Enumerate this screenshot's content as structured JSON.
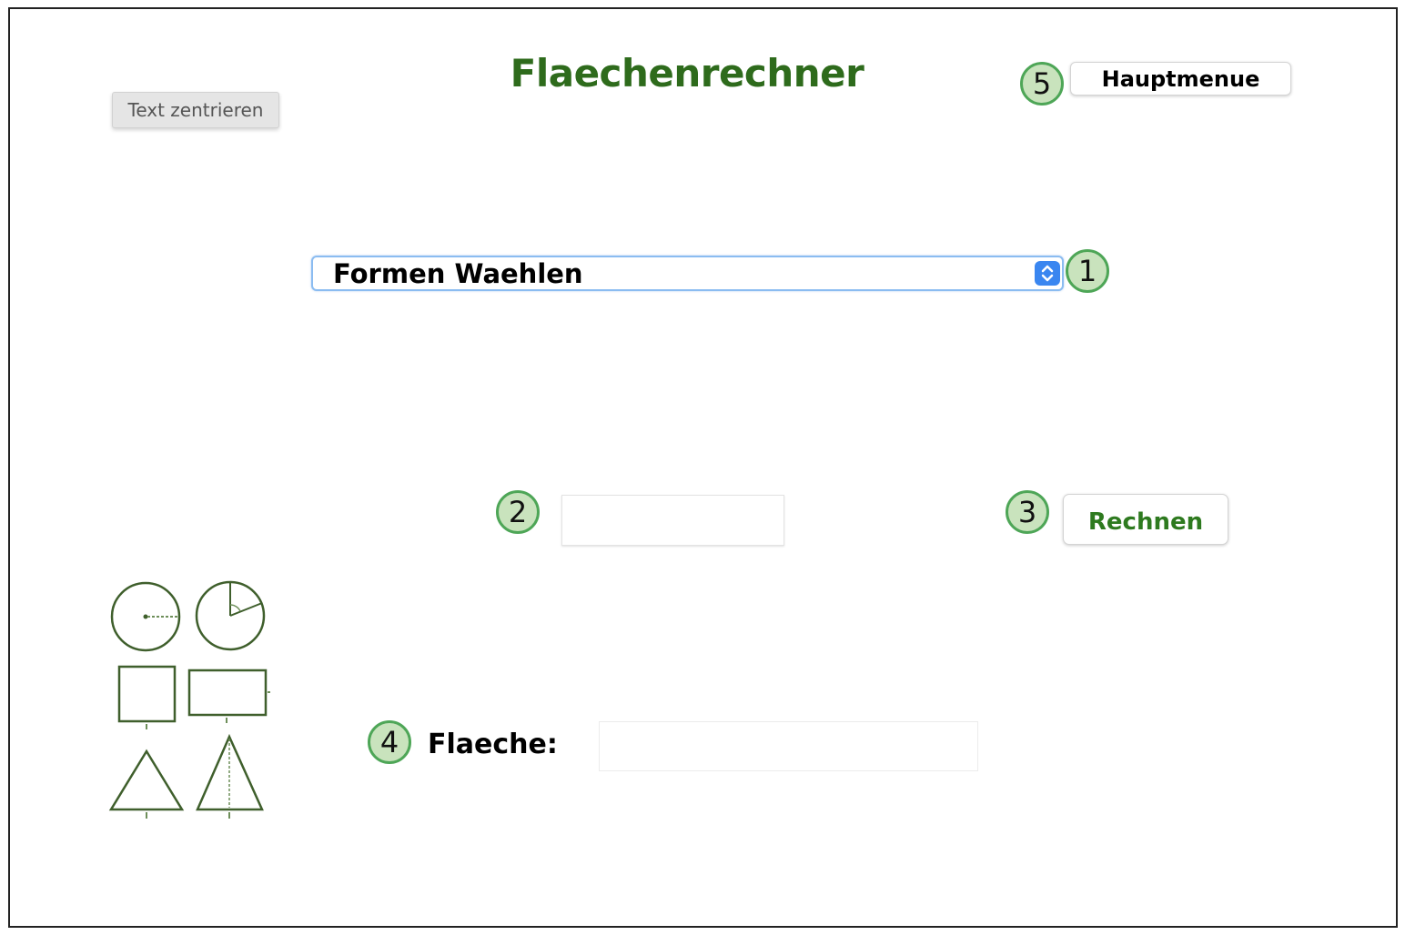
{
  "app": {
    "title": "Flaechenrechner"
  },
  "toolbar": {
    "center_text_label": "Text zentrieren",
    "main_menu_label": "Hauptmenue"
  },
  "form": {
    "shape_select": {
      "selected": "Formen Waehlen"
    },
    "input_value": "",
    "calculate_label": "Rechnen",
    "area_label": "Flaeche:",
    "area_value": ""
  },
  "badges": [
    "1",
    "2",
    "3",
    "4",
    "5"
  ],
  "shapes_icons": [
    "circle-radius-icon",
    "circle-sector-icon",
    "square-icon",
    "rectangle-icon",
    "triangle-icon",
    "triangle-height-icon"
  ],
  "colors": {
    "title": "#2e6b1c",
    "accent_green": "#2e7a1f",
    "badge_fill": "#c9e3bd",
    "badge_border": "#4ea657",
    "select_arrow": "#3a86f0"
  }
}
